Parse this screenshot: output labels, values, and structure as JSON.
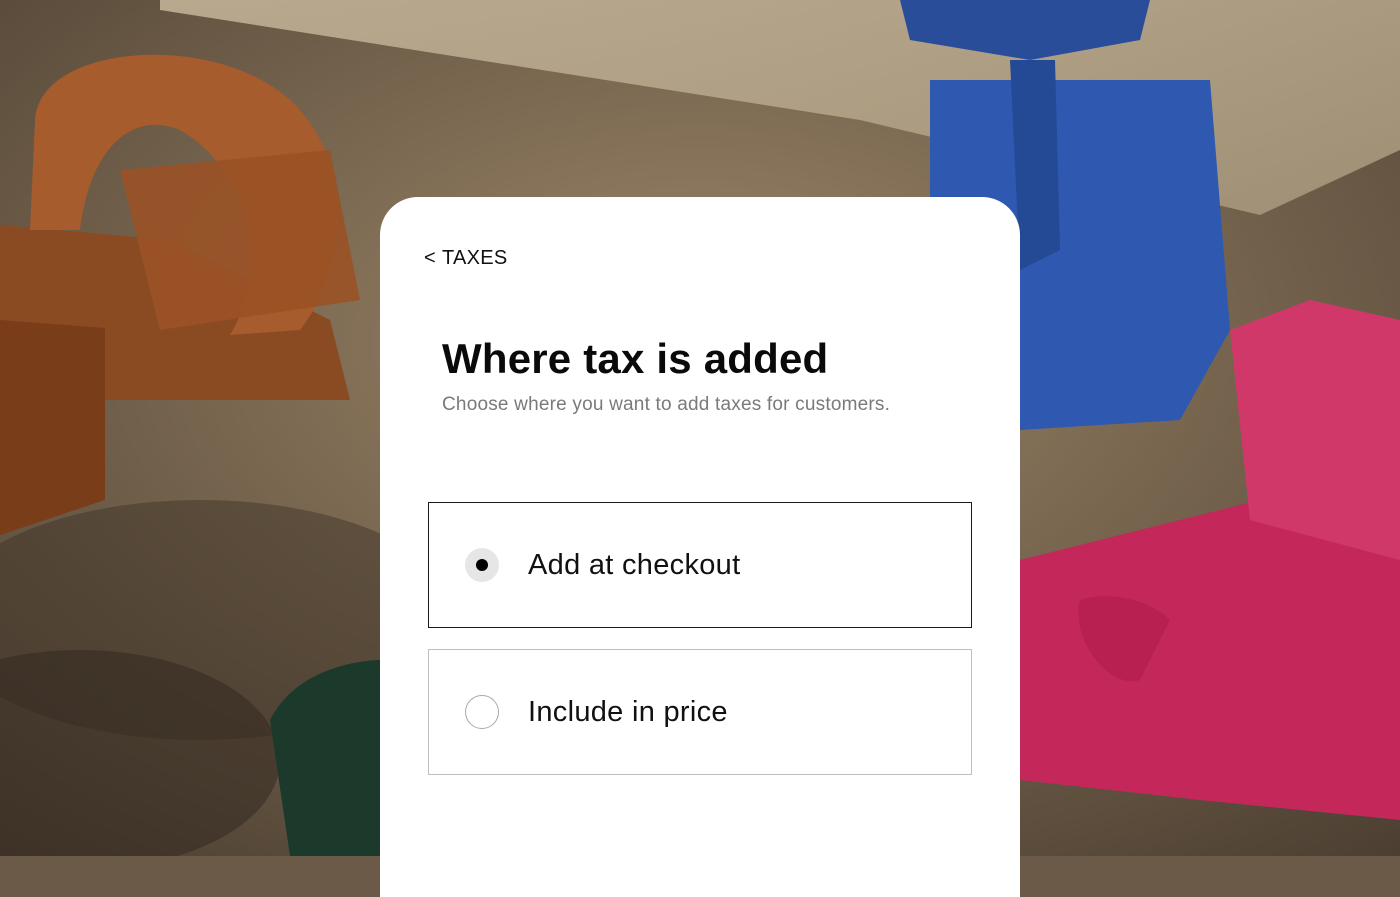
{
  "back_link": {
    "chevron": "<",
    "label": "TAXES"
  },
  "title": "Where tax is added",
  "subtitle": "Choose where you want to add taxes for customers.",
  "options": [
    {
      "label": "Add at checkout",
      "selected": true
    },
    {
      "label": "Include in price",
      "selected": false
    }
  ],
  "colors": {
    "panel": "#ffffff",
    "selected_border": "#1a1a1a",
    "unselected_border": "#bdbdbd",
    "subtitle": "#7a7a7a"
  }
}
